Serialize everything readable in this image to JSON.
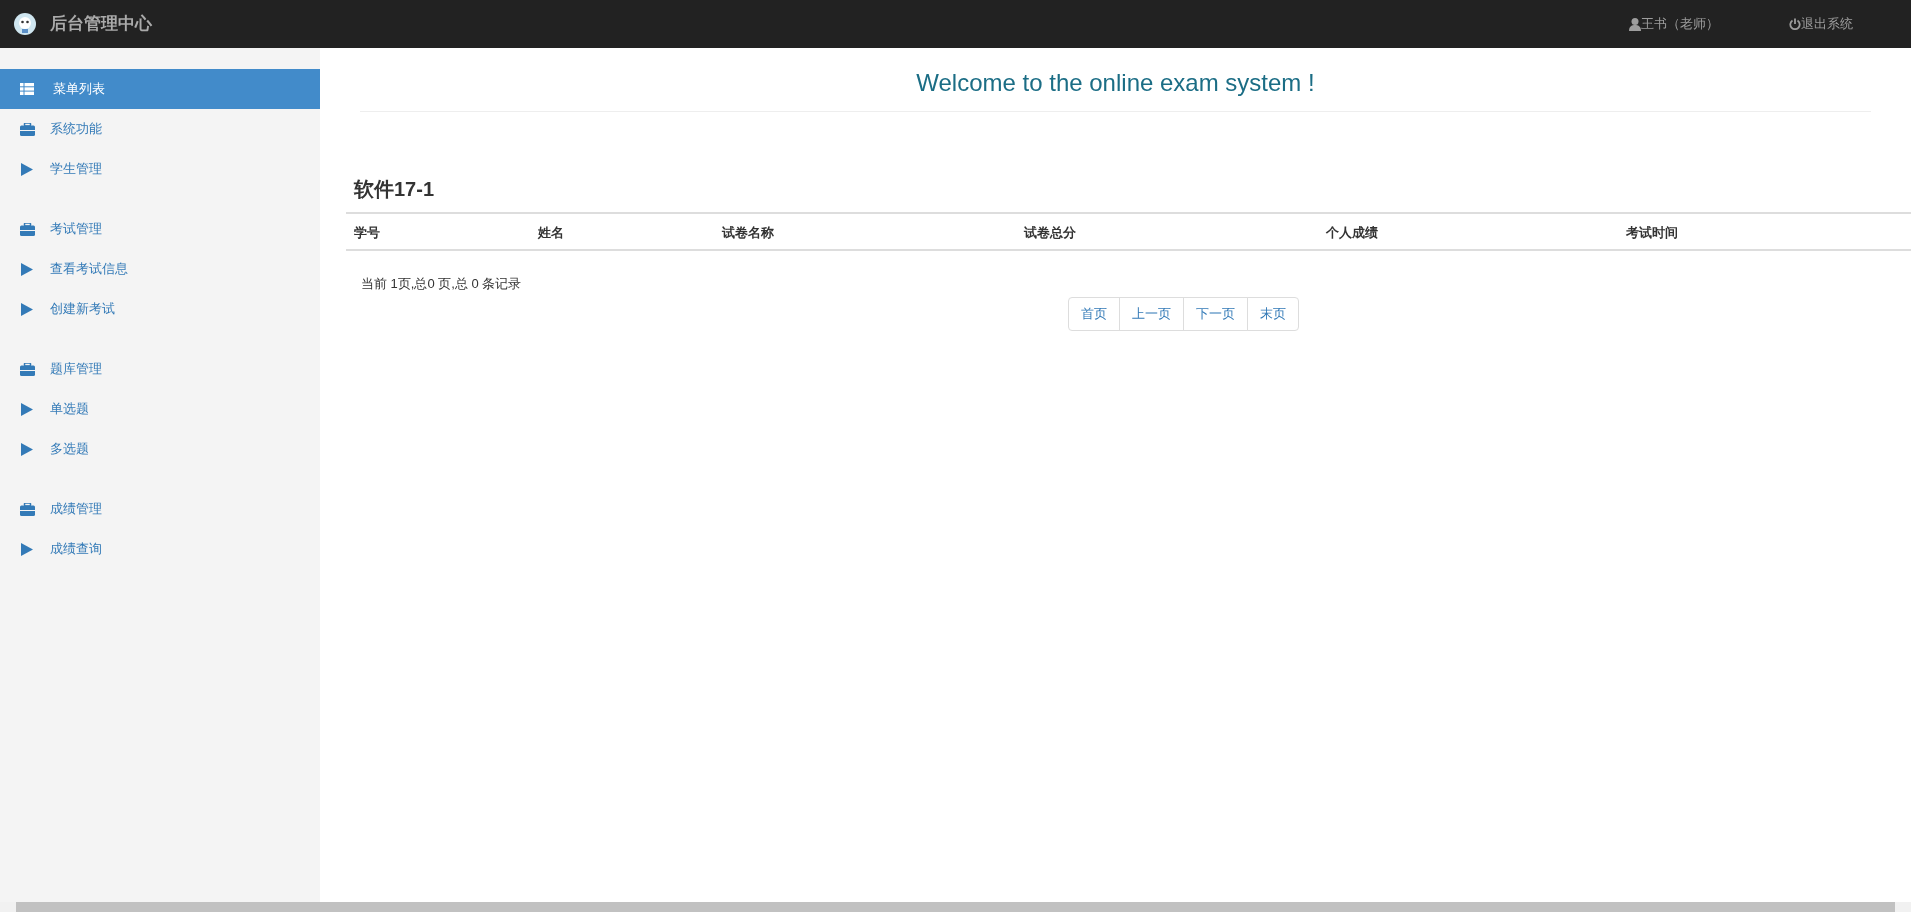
{
  "header": {
    "title": "后台管理中心",
    "user": "王书（老师）",
    "logout": "退出系统"
  },
  "sidebar": {
    "menu_header": {
      "label": "菜单列表",
      "selected": true
    },
    "groups": [
      {
        "label": "系统功能",
        "items": [
          {
            "label": "学生管理",
            "selected": false
          }
        ]
      },
      {
        "label": "考试管理",
        "items": [
          {
            "label": "查看考试信息",
            "selected": false
          },
          {
            "label": "创建新考试",
            "selected": false
          }
        ]
      },
      {
        "label": "题库管理",
        "items": [
          {
            "label": "单选题",
            "selected": false
          },
          {
            "label": "多选题",
            "selected": false
          }
        ]
      },
      {
        "label": "成绩管理",
        "items": [
          {
            "label": "成绩查询",
            "selected": false
          }
        ]
      }
    ]
  },
  "main": {
    "welcome": "Welcome to the online exam system !",
    "class_title": "软件17-1",
    "table": {
      "columns": [
        "学号",
        "姓名",
        "试卷名称",
        "试卷总分",
        "个人成绩",
        "考试时间"
      ]
    },
    "page_info": "当前 1页,总0 页,总 0 条记录",
    "pagination": [
      "首页",
      "上一页",
      "下一页",
      "末页"
    ]
  }
}
